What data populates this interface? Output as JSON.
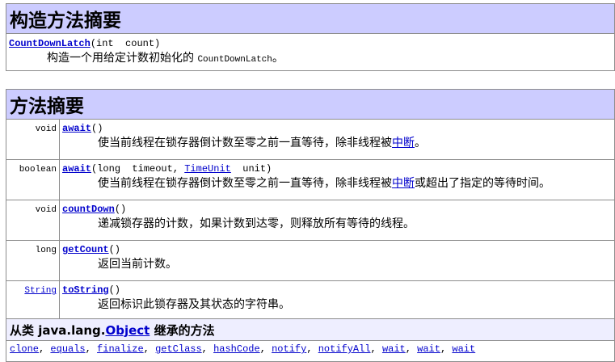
{
  "constructor_summary": {
    "title": "构造方法摘要",
    "signature_name": "CountDownLatch",
    "signature_params": "(int  count)",
    "description_prefix": "构造一个用给定计数初始化的 ",
    "description_code": "CountDownLatch",
    "description_suffix": "。"
  },
  "method_summary": {
    "title": "方法摘要",
    "methods": [
      {
        "return_type": "void",
        "name": "await",
        "params_prefix": "()",
        "params_link": "",
        "params_suffix": "",
        "desc_prefix": "使当前线程在锁存器倒计数至零之前一直等待，除非线程被",
        "desc_link": "中断",
        "desc_suffix": "。"
      },
      {
        "return_type": "boolean",
        "name": "await",
        "params_prefix": "(long  timeout, ",
        "params_link": "TimeUnit",
        "params_suffix": "  unit)",
        "desc_prefix": "使当前线程在锁存器倒计数至零之前一直等待，除非线程被",
        "desc_link": "中断",
        "desc_suffix": "或超出了指定的等待时间。"
      },
      {
        "return_type": "void",
        "name": "countDown",
        "params_prefix": "()",
        "params_link": "",
        "params_suffix": "",
        "desc_prefix": "递减锁存器的计数，如果计数到达零，则释放所有等待的线程。",
        "desc_link": "",
        "desc_suffix": ""
      },
      {
        "return_type": "long",
        "name": "getCount",
        "params_prefix": "()",
        "params_link": "",
        "params_suffix": "",
        "desc_prefix": "返回当前计数。",
        "desc_link": "",
        "desc_suffix": ""
      },
      {
        "return_type": "String",
        "name": "toString",
        "params_prefix": "()",
        "params_link": "",
        "params_suffix": "",
        "desc_prefix": "返回标识此锁存器及其状态的字符串。",
        "desc_link": "",
        "desc_suffix": ""
      }
    ]
  },
  "inherited": {
    "title_prefix": "从类 java.lang.",
    "title_link": "Object",
    "title_suffix": " 继承的方法",
    "separator": ", ",
    "methods": [
      "clone",
      "equals",
      "finalize",
      "getClass",
      "hashCode",
      "notify",
      "notifyAll",
      "wait",
      "wait",
      "wait"
    ]
  }
}
